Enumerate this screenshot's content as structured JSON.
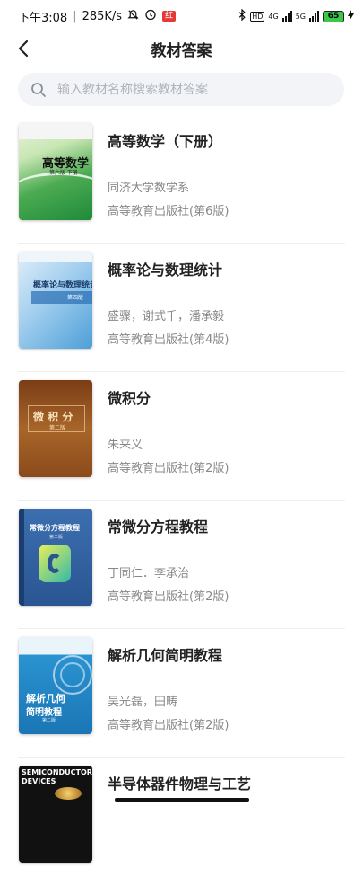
{
  "status_bar": {
    "time": "下午3:08",
    "speed": "285K/s",
    "network_left": "4G",
    "network_right": "5G",
    "battery": "65",
    "notification_badge": "红"
  },
  "header": {
    "back_icon": "chevron-left-icon",
    "title": "教材答案"
  },
  "search": {
    "icon": "search-icon",
    "placeholder": "输入教材名称搜索教材答案",
    "value": ""
  },
  "books": [
    {
      "title": "高等数学（下册）",
      "author": "同济大学数学系",
      "publisher": "高等教育出版社(第6版)",
      "cover_title": "高等数学",
      "cover_sub": "第六版 下册",
      "cover_color": "#3fa34d"
    },
    {
      "title": "概率论与数理统计",
      "author": "盛骤，谢式千，潘承毅",
      "publisher": "高等教育出版社(第4版)",
      "cover_title": "概率论与数理统计",
      "cover_sub": "第四版",
      "cover_color": "#5aa5d8"
    },
    {
      "title": "微积分",
      "author": "朱来义",
      "publisher": "高等教育出版社(第2版)",
      "cover_title": "微 积 分",
      "cover_sub": "第二版",
      "cover_color": "#9a5a22"
    },
    {
      "title": "常微分方程教程",
      "author": "丁同仁．李承治",
      "publisher": "高等教育出版社(第2版)",
      "cover_title": "常微分方程教程",
      "cover_sub": "第二版",
      "cover_color": "#2f5fa0"
    },
    {
      "title": "解析几何简明教程",
      "author": "吴光磊，田畴",
      "publisher": "高等教育出版社(第2版)",
      "cover_title": "解析几何",
      "cover_title2": "简明教程",
      "cover_sub": "第二版",
      "cover_color": "#1d86c6"
    },
    {
      "title": "半导体器件物理与工艺",
      "author": "",
      "publisher": "",
      "cover_title": "SEMICONDUCTOR",
      "cover_title2": "DEVICES",
      "cover_color": "#111111"
    }
  ]
}
